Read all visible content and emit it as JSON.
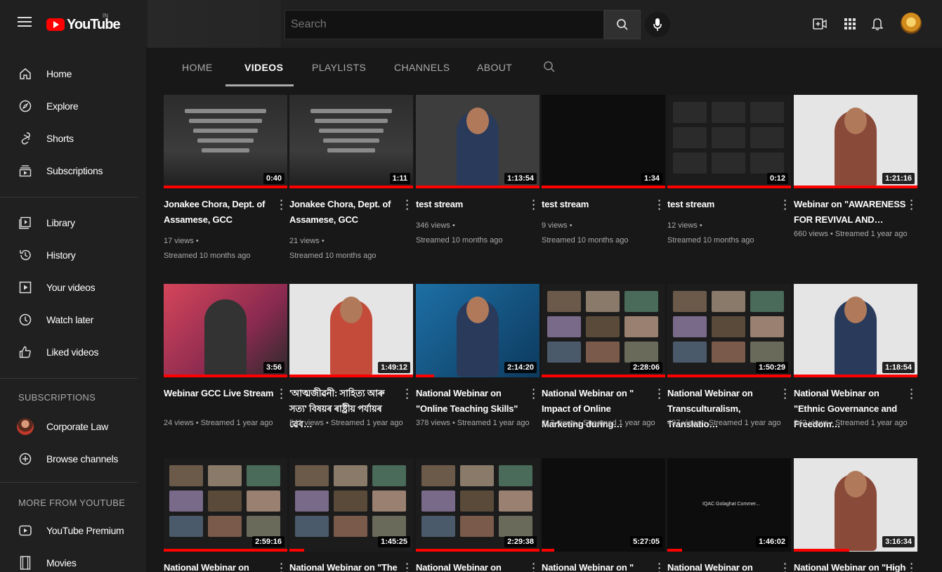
{
  "topbar": {
    "logo_text": "YouTube",
    "country_code": "IN",
    "search_placeholder": "Search"
  },
  "tabs": {
    "home": "HOME",
    "videos": "VIDEOS",
    "playlists": "PLAYLISTS",
    "channels": "CHANNELS",
    "about": "ABOUT"
  },
  "sidebar": {
    "main": [
      "Home",
      "Explore",
      "Shorts",
      "Subscriptions"
    ],
    "you": [
      "Library",
      "History",
      "Your videos",
      "Watch later",
      "Liked videos"
    ],
    "subscriptions_heading": "SUBSCRIPTIONS",
    "subscriptions": [
      "Corporate Law",
      "Browse channels"
    ],
    "more_heading": "MORE FROM YOUTUBE",
    "more": [
      "YouTube Premium",
      "Movies"
    ]
  },
  "videos": [
    {
      "title": "Jonakee Chora, Dept. of Assamese, GCC",
      "views": "17 views •",
      "age": "Streamed 10 months ago",
      "duration": "0:40",
      "progress": 1.0
    },
    {
      "title": "Jonakee Chora, Dept. of Assamese, GCC",
      "views": "21 views •",
      "age": "Streamed 10 months ago",
      "duration": "1:11",
      "progress": 1.0
    },
    {
      "title": "test stream",
      "views": "346 views •",
      "age": "Streamed 10 months ago",
      "duration": "1:13:54",
      "progress": 1.0
    },
    {
      "title": "test stream",
      "views": "9 views •",
      "age": "Streamed 10 months ago",
      "duration": "1:34",
      "progress": 1.0
    },
    {
      "title": "test stream",
      "views": "12 views •",
      "age": "Streamed 10 months ago",
      "duration": "0:12",
      "progress": 1.0
    },
    {
      "title": "Webinar on \"AWARENESS FOR REVIVAL AND…",
      "views": "660 views • Streamed 1 year ago",
      "age": "",
      "duration": "1:21:16",
      "progress": 1.0
    },
    {
      "title": "Webinar GCC Live Stream",
      "views": "24 views • Streamed 1 year ago",
      "age": "",
      "duration": "3:56",
      "progress": 1.0
    },
    {
      "title": "'আত্মজীৱনী: সাহিত্য আৰু সত্য' বিষয়ৰ ৰাষ্ট্ৰীয় পৰ্যায়ৰ ৱেব…",
      "views": "541 views • Streamed 1 year ago",
      "age": "",
      "duration": "1:49:12",
      "progress": 1.0
    },
    {
      "title": "National Webinar on \"Online Teaching Skills\"",
      "views": "378 views • Streamed 1 year ago",
      "age": "",
      "duration": "2:14:20",
      "progress": 0.15
    },
    {
      "title": "National Webinar on \" Impact of Online Marketing during…",
      "views": "213 views • Streamed 1 year ago",
      "age": "",
      "duration": "2:28:06",
      "progress": 1.0
    },
    {
      "title": "National Webinar on Transculturalism, Translatio…",
      "views": "427 views • Streamed 1 year ago",
      "age": "",
      "duration": "1:50:29",
      "progress": 1.0
    },
    {
      "title": "National Webinar on \"Ethnic Governance and Freedom…",
      "views": "342 views • Streamed 1 year ago",
      "age": "",
      "duration": "1:18:54",
      "progress": 1.0
    },
    {
      "title": "National Webinar on",
      "views": "",
      "age": "",
      "duration": "2:59:16",
      "progress": 1.0
    },
    {
      "title": "National Webinar on \"The",
      "views": "",
      "age": "",
      "duration": "1:45:25",
      "progress": 0.12
    },
    {
      "title": "National Webinar on",
      "views": "",
      "age": "",
      "duration": "2:29:38",
      "progress": 1.0
    },
    {
      "title": "National Webinar on \"",
      "views": "",
      "age": "",
      "duration": "5:27:05",
      "progress": 0.1
    },
    {
      "title": "National Webinar on",
      "views": "",
      "age": "",
      "duration": "1:46:02",
      "progress": 0.12,
      "thumb_text": "IQAC Golaghat Commer..."
    },
    {
      "title": "National Webinar on \"Higher",
      "views": "",
      "age": "",
      "duration": "3:16:34",
      "progress": 0.45
    }
  ]
}
